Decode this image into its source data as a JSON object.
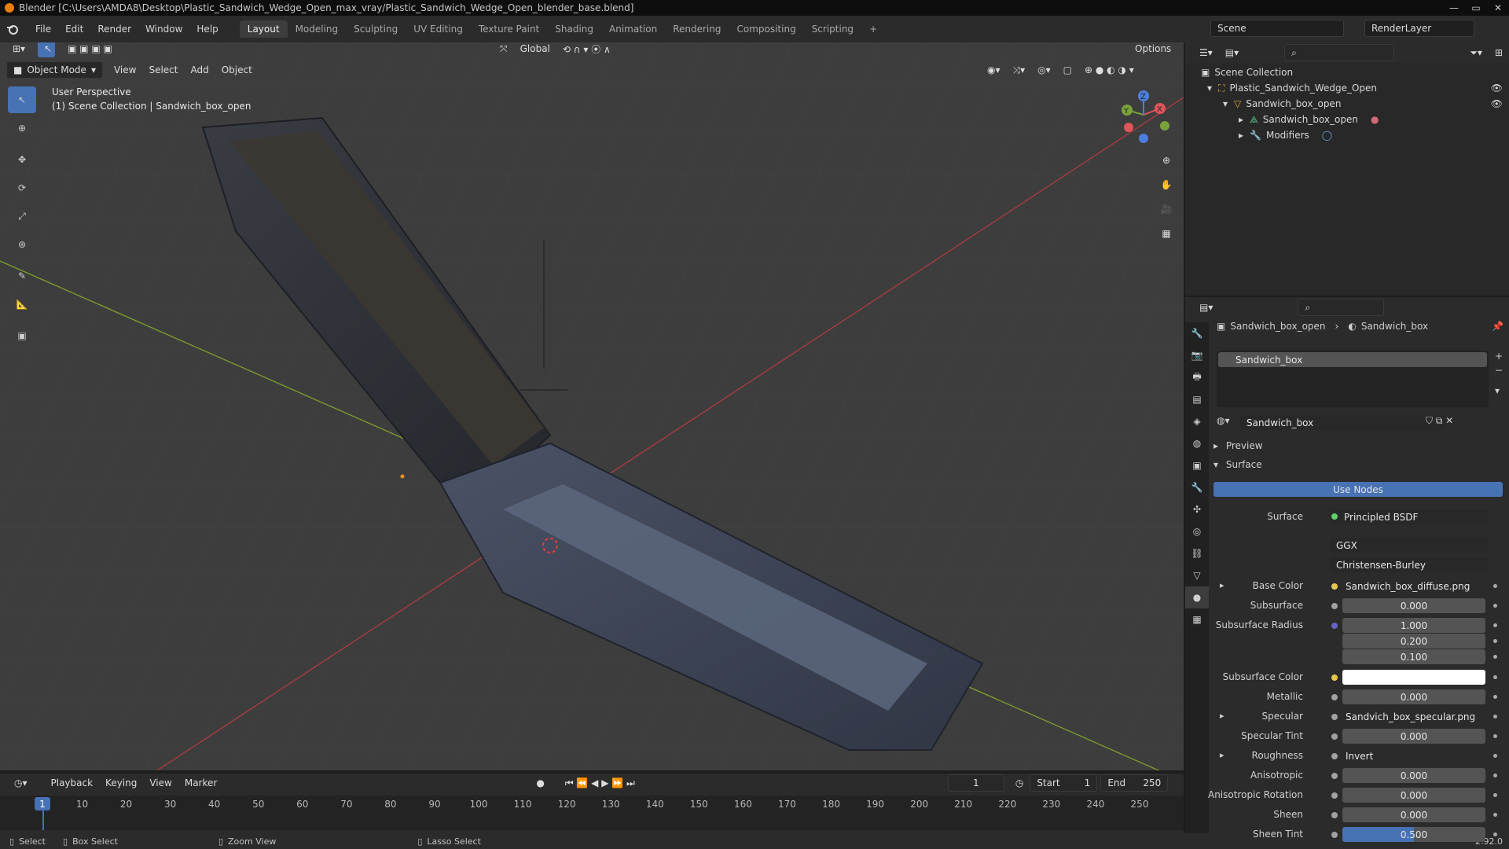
{
  "window": {
    "title": "Blender [C:\\Users\\AMDA8\\Desktop\\Plastic_Sandwich_Wedge_Open_max_vray/Plastic_Sandwich_Wedge_Open_blender_base.blend]"
  },
  "menu": [
    "File",
    "Edit",
    "Render",
    "Window",
    "Help"
  ],
  "workspaces": [
    "Layout",
    "Modeling",
    "Sculpting",
    "UV Editing",
    "Texture Paint",
    "Shading",
    "Animation",
    "Rendering",
    "Compositing",
    "Scripting"
  ],
  "active_workspace": "Layout",
  "scene": {
    "name": "Scene",
    "render_layer": "RenderLayer"
  },
  "viewport": {
    "transform_orientation": "Global",
    "options_label": "Options",
    "mode": "Object Mode",
    "header_menu": [
      "View",
      "Select",
      "Add",
      "Object"
    ],
    "perspective": "User Perspective",
    "collection_info": "(1) Scene Collection | Sandwich_box_open",
    "gizmo": {
      "x": "X",
      "y": "Y",
      "z": "Z"
    }
  },
  "outliner": {
    "root": "Scene Collection",
    "items": [
      {
        "label": "Plastic_Sandwich_Wedge_Open"
      },
      {
        "label": "Sandwich_box_open"
      },
      {
        "label": "Sandwich_box_open"
      },
      {
        "label": "Modifiers"
      }
    ]
  },
  "properties": {
    "breadcrumb_object": "Sandwich_box_open",
    "breadcrumb_material": "Sandwich_box",
    "slot": "Sandwich_box",
    "material_name": "Sandwich_box",
    "panel_preview": "Preview",
    "panel_surface": "Surface",
    "use_nodes": "Use Nodes",
    "surface_label": "Surface",
    "surface_value": "Principled BSDF",
    "distribution": "GGX",
    "subsurface_method": "Christensen-Burley",
    "rows": [
      {
        "label": "Base Color",
        "value": "Sandwich_box_diffuse.png",
        "dot": "#e5c84b"
      },
      {
        "label": "Subsurface",
        "value": "0.000",
        "dot": "#a1a1a1"
      },
      {
        "label": "Subsurface Radius",
        "value": "1.000",
        "dot": "#6363c7"
      },
      {
        "label": "",
        "value": "0.200"
      },
      {
        "label": "",
        "value": "0.100"
      },
      {
        "label": "Subsurface Color",
        "value": "",
        "dot": "#e5c84b"
      },
      {
        "label": "Metallic",
        "value": "0.000",
        "dot": "#a1a1a1"
      },
      {
        "label": "Specular",
        "value": "Sandvich_box_specular.png",
        "dot": "#a1a1a1"
      },
      {
        "label": "Specular Tint",
        "value": "0.000",
        "dot": "#a1a1a1"
      },
      {
        "label": "Roughness",
        "value": "Invert",
        "dot": "#a1a1a1"
      },
      {
        "label": "Anisotropic",
        "value": "0.000",
        "dot": "#a1a1a1"
      },
      {
        "label": "Anisotropic Rotation",
        "value": "0.000",
        "dot": "#a1a1a1"
      },
      {
        "label": "Sheen",
        "value": "0.000",
        "dot": "#a1a1a1"
      },
      {
        "label": "Sheen Tint",
        "value": "0.500",
        "dot": "#a1a1a1"
      }
    ]
  },
  "timeline": {
    "menu": [
      "Playback",
      "Keying",
      "View",
      "Marker"
    ],
    "current_frame": "1",
    "start_label": "Start",
    "start": "1",
    "end_label": "End",
    "end": "250",
    "ticks": [
      "1",
      "10",
      "20",
      "30",
      "40",
      "50",
      "60",
      "70",
      "80",
      "90",
      "100",
      "110",
      "120",
      "130",
      "140",
      "150",
      "160",
      "170",
      "180",
      "190",
      "200",
      "210",
      "220",
      "230",
      "240",
      "250"
    ]
  },
  "status": {
    "select": "Select",
    "box_select": "Box Select",
    "zoom_view": "Zoom View",
    "lasso_select": "Lasso Select",
    "version": "2.92.0"
  },
  "colors": {
    "accent": "#4772b3",
    "header": "#2b2b2b",
    "viewport": "#3d3d3d"
  }
}
